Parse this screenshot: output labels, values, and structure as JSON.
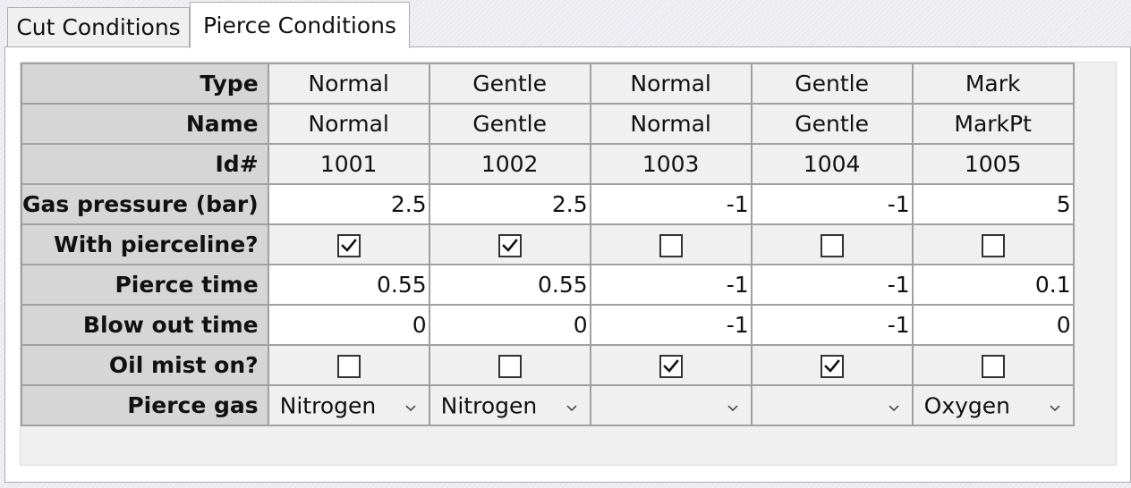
{
  "tabs": [
    {
      "label": "Cut Conditions",
      "active": false
    },
    {
      "label": "Pierce Conditions",
      "active": true
    }
  ],
  "rows": {
    "type": {
      "label": "Type",
      "values": [
        "Normal",
        "Gentle",
        "Normal",
        "Gentle",
        "Mark"
      ]
    },
    "name": {
      "label": "Name",
      "values": [
        "Normal",
        "Gentle",
        "Normal",
        "Gentle",
        "MarkPt"
      ]
    },
    "id": {
      "label": "Id#",
      "values": [
        "1001",
        "1002",
        "1003",
        "1004",
        "1005"
      ]
    },
    "gas_pressure": {
      "label": "Gas pressure (bar)",
      "values": [
        "2.5",
        "2.5",
        "-1",
        "-1",
        "5"
      ]
    },
    "with_pierceline": {
      "label": "With pierceline?",
      "checked": [
        true,
        true,
        false,
        false,
        false
      ]
    },
    "pierce_time": {
      "label": "Pierce time",
      "values": [
        "0.55",
        "0.55",
        "-1",
        "-1",
        "0.1"
      ]
    },
    "blow_out_time": {
      "label": "Blow out time",
      "values": [
        "0",
        "0",
        "-1",
        "-1",
        "0"
      ]
    },
    "oil_mist_on": {
      "label": "Oil mist on?",
      "checked": [
        false,
        false,
        true,
        true,
        false
      ]
    },
    "pierce_gas": {
      "label": "Pierce gas",
      "values": [
        "Nitrogen",
        "Nitrogen",
        "",
        "",
        "Oxygen"
      ]
    }
  },
  "icons": {
    "checkmark": "checkmark-icon",
    "dropdown": "chevron-down-icon"
  }
}
